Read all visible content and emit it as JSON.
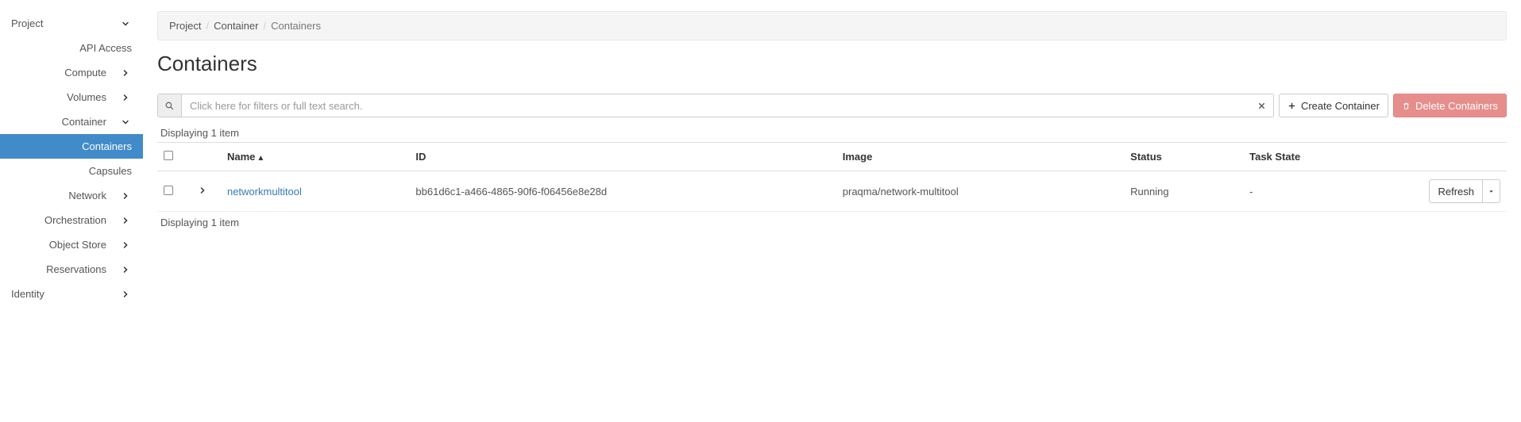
{
  "sidebar": {
    "project_label": "Project",
    "api_access_label": "API Access",
    "compute_label": "Compute",
    "volumes_label": "Volumes",
    "container_label": "Container",
    "containers_label": "Containers",
    "capsules_label": "Capsules",
    "network_label": "Network",
    "orchestration_label": "Orchestration",
    "object_store_label": "Object Store",
    "reservations_label": "Reservations",
    "identity_label": "Identity"
  },
  "breadcrumb": {
    "items": [
      "Project",
      "Container",
      "Containers"
    ]
  },
  "page": {
    "title": "Containers"
  },
  "search": {
    "placeholder": "Click here for filters or full text search."
  },
  "toolbar": {
    "create_label": "Create Container",
    "delete_label": "Delete Containers"
  },
  "count_text_top": "Displaying 1 item",
  "count_text_bottom": "Displaying 1 item",
  "table": {
    "headers": {
      "name": "Name",
      "id": "ID",
      "image": "Image",
      "status": "Status",
      "task_state": "Task State"
    },
    "rows": [
      {
        "name": "networkmultitool",
        "id": "bb61d6c1-a466-4865-90f6-f06456e8e28d",
        "image": "praqma/network-multitool",
        "status": "Running",
        "task_state": "-",
        "action_label": "Refresh"
      }
    ]
  }
}
